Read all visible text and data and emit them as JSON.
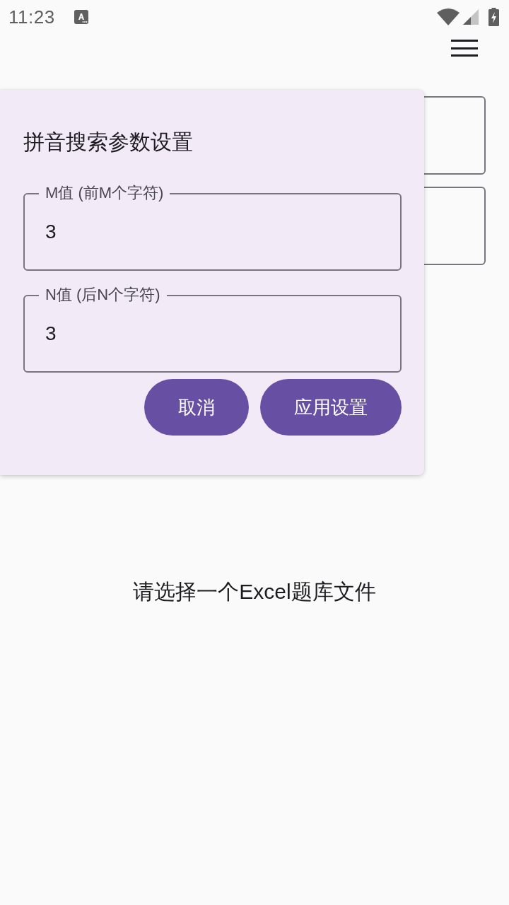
{
  "status_bar": {
    "time": "11:23"
  },
  "dialog": {
    "title": "拼音搜索参数设置",
    "fields": [
      {
        "label": "M值 (前M个字符)",
        "value": "3"
      },
      {
        "label": "N值 (后N个字符)",
        "value": "3"
      }
    ],
    "buttons": [
      "取消",
      "应用设置"
    ]
  },
  "message": "请选择一个Excel题库文件"
}
